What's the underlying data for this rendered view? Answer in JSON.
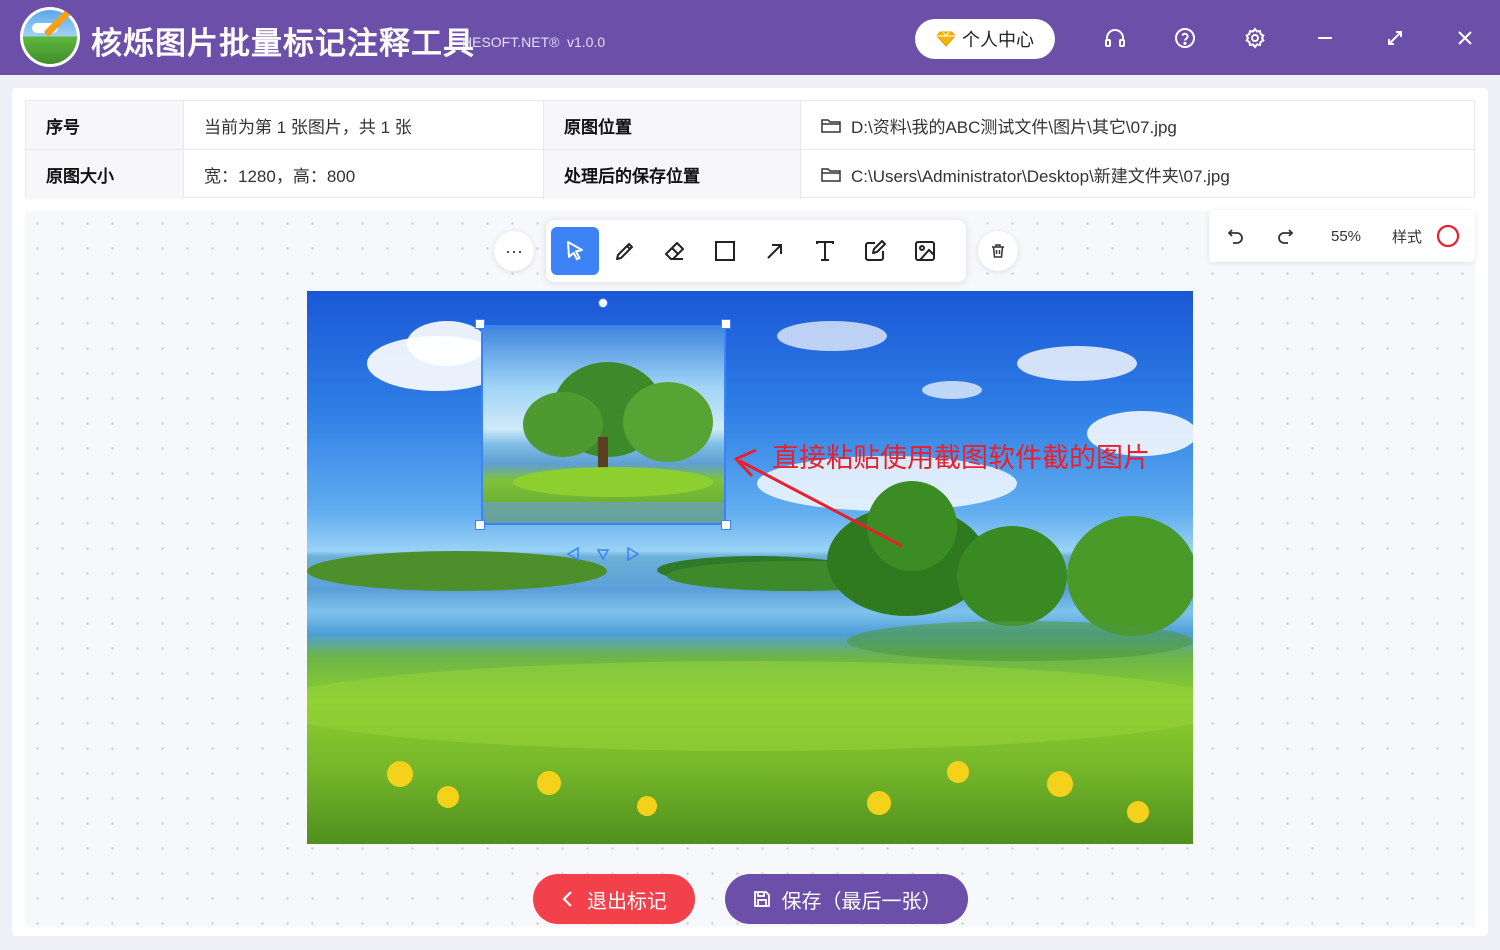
{
  "app": {
    "title": "核烁图片批量标记注释工具",
    "subtitle": "HESOFT.NET®",
    "version": "v1.0.0",
    "user_center_label": "个人中心"
  },
  "window_controls": [
    "headset-icon",
    "help-icon",
    "settings-icon",
    "minimize-icon",
    "maximize-icon",
    "close-icon"
  ],
  "info_table": {
    "row1": {
      "label_index": "序号",
      "value_index": "当前为第 1 张图片，共 1 张",
      "label_source": "原图位置",
      "value_source": "D:\\资料\\我的ABC测试文件\\图片\\其它\\07.jpg"
    },
    "row2": {
      "label_size": "原图大小",
      "value_size": "宽：1280，高：800",
      "label_output": "处理后的保存位置",
      "value_output": "C:\\Users\\Administrator\\Desktop\\新建文件夹\\07.jpg"
    }
  },
  "toolbar": {
    "more_label": "···",
    "tools": [
      "select-icon",
      "pencil-icon",
      "eraser-icon",
      "rectangle-icon",
      "arrow-icon",
      "text-icon",
      "edit-icon",
      "image-icon"
    ],
    "active_tool": "select-icon",
    "delete_icon": "trash-icon"
  },
  "right_panel": {
    "undo_icon": "undo-icon",
    "redo_icon": "redo-icon",
    "zoom": "55%",
    "style_label": "样式",
    "style_color": "#e8202e"
  },
  "annotation": {
    "text": "直接粘贴使用截图软件截的图片",
    "color": "#e8202e"
  },
  "buttons": {
    "exit_label": "退出标记",
    "save_label": "保存（最后一张）"
  },
  "colors": {
    "brand": "#6b4fa8",
    "accent": "#3d82f6",
    "danger": "#f2414b"
  }
}
